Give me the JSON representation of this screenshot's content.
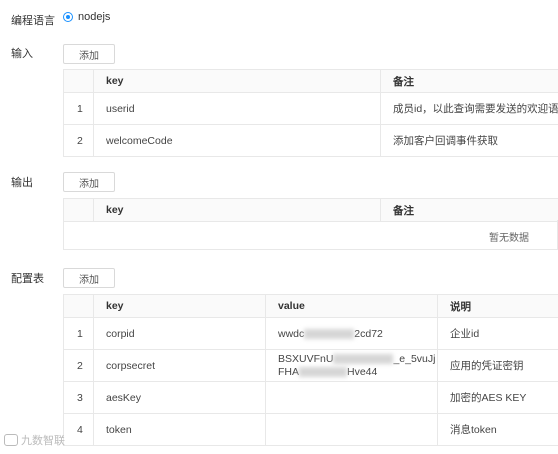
{
  "language": {
    "label": "编程语言",
    "option": "nodejs"
  },
  "input": {
    "label": "输入",
    "add_label": "添加",
    "headers": [
      "key",
      "备注"
    ],
    "rows": [
      {
        "index": "1",
        "key": "userid",
        "note": "成员id，以此查询需要发送的欢迎语"
      },
      {
        "index": "2",
        "key": "welcomeCode",
        "note": "添加客户回调事件获取"
      }
    ]
  },
  "output": {
    "label": "输出",
    "add_label": "添加",
    "headers": [
      "key",
      "备注"
    ],
    "empty_text": "暂无数据"
  },
  "config": {
    "label": "配置表",
    "add_label": "添加",
    "headers": [
      "key",
      "value",
      "说明"
    ],
    "rows": [
      {
        "index": "1",
        "key": "corpid",
        "value_a": "wwdc",
        "value_b": "2cd72",
        "desc": "企业id"
      },
      {
        "index": "2",
        "key": "corpsecret",
        "value_a": "BSXUVFnU",
        "value_b": "_e_5vuJj",
        "value_c": "FHA",
        "value_d": "Hve44",
        "desc": "应用的凭证密钥"
      },
      {
        "index": "3",
        "key": "aesKey",
        "desc": "加密的AES KEY"
      },
      {
        "index": "4",
        "key": "token",
        "desc": "消息token"
      }
    ]
  },
  "watermark": "九数智联"
}
